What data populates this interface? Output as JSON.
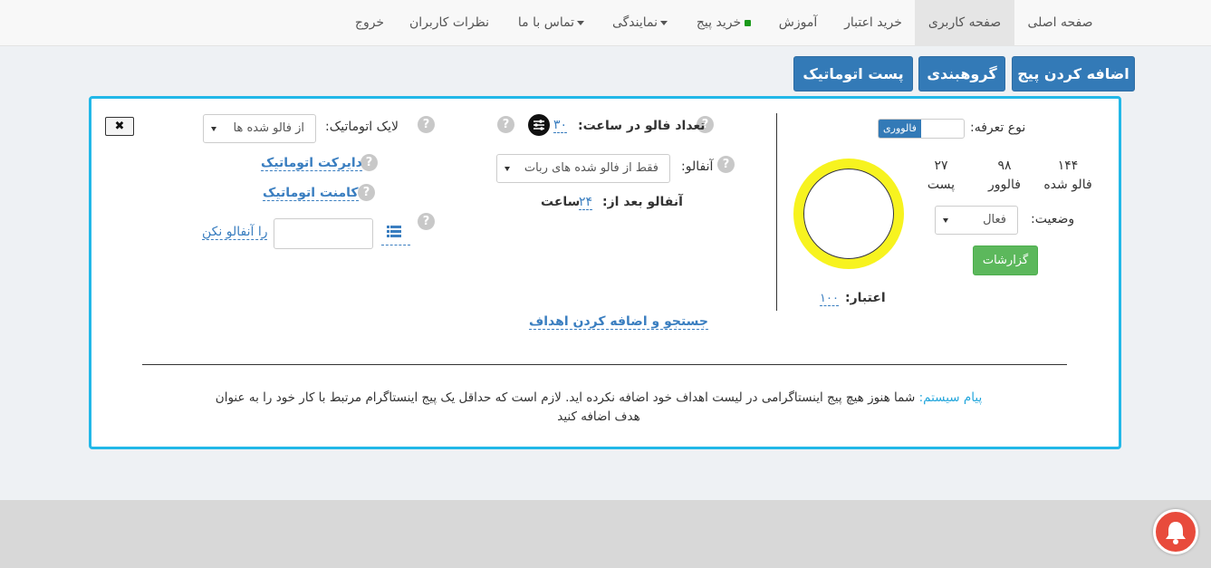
{
  "nav": {
    "items": [
      {
        "label": "صفحه اصلی"
      },
      {
        "label": "صفحه کاربری"
      },
      {
        "label": "خرید اعتبار"
      },
      {
        "label": "آموزش"
      },
      {
        "label": "خرید پیج"
      },
      {
        "label": "نمایندگی"
      },
      {
        "label": "تماس با ما"
      },
      {
        "label": "نظرات کاربران"
      },
      {
        "label": "خروج"
      }
    ]
  },
  "actions": {
    "add_page": "اضافه کردن پیج",
    "grouping": "گروهبندی",
    "auto_post": "پست اتوماتیک"
  },
  "profile": {
    "tariff_label": "نوع تعرفه:",
    "tariff_value": "فالووری",
    "stats": [
      {
        "value": "۱۴۴",
        "label": "فالو شده"
      },
      {
        "value": "۹۸",
        "label": "فالوور"
      },
      {
        "value": "۲۷",
        "label": "پست"
      }
    ],
    "status_label": "وضعیت:",
    "status_value": "فعال",
    "reports_button": "گزارشات",
    "credit_label": "اعتبار:",
    "credit_value": "۱۰۰"
  },
  "follow": {
    "per_hour_label": "تعداد فالو در ساعت:",
    "per_hour_value": "۳۰",
    "unfollow_label": "آنفالو:",
    "unfollow_value": "فقط از فالو شده های ربات",
    "unfollow_after_label": "آنفالو بعد از:",
    "unfollow_after_value": "۲۴",
    "unfollow_after_unit": "ساعت",
    "search_targets": "جستجو و اضافه کردن اهداف"
  },
  "auto": {
    "like_label": "لایک اتوماتیک:",
    "like_value": "از فالو شده ها",
    "direct": "دایرکت اتوماتیک",
    "comment": "کامنت اتوماتیک",
    "no_unfollow_input": "",
    "no_unfollow_label": "را آنفالو نکن",
    "close": "✖"
  },
  "message": {
    "prefix": "پیام سیستم:",
    "line1": "شما هنوز هیچ پیج اینستاگرامی در لیست اهداف خود اضافه نکرده اید. لازم است که حداقل یک پیج اینستاگرام مرتبط با کار خود را به عنوان",
    "line2": "هدف اضافه کنید"
  },
  "icons": {
    "help": "question-circle-icon",
    "list": "list-icon",
    "sliders": "sliders-icon",
    "bell": "bell-icon",
    "close": "close-icon"
  },
  "colors": {
    "accent": "#337ab7",
    "panel_border": "#22b8e8",
    "success": "#5cb85c",
    "avatar_ring": "#f7f31f",
    "notify": "#e84b3c"
  }
}
